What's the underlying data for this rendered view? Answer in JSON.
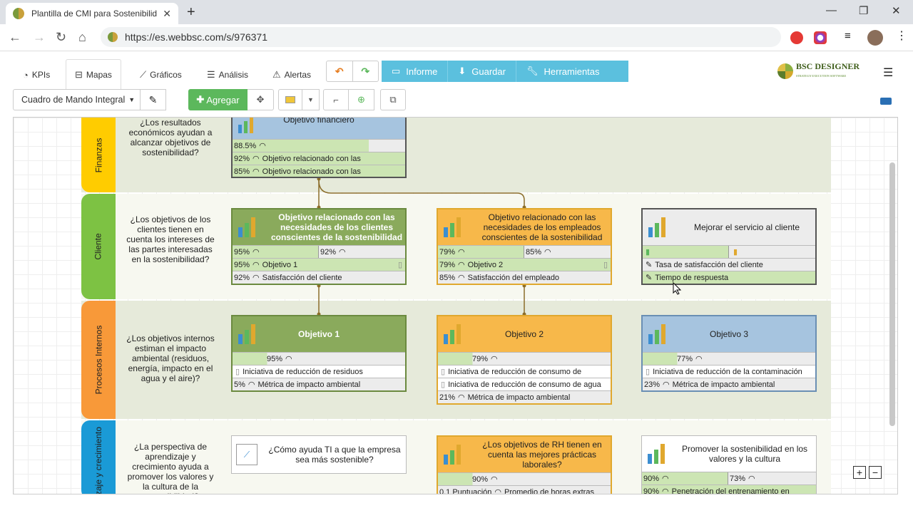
{
  "browser": {
    "tab_title": "Plantilla de CMI para Sostenibilid",
    "url": "https://es.webbsc.com/s/976371"
  },
  "nav": {
    "tabs": [
      {
        "label": "KPIs"
      },
      {
        "label": "Mapas"
      },
      {
        "label": "Gráficos"
      },
      {
        "label": "Análisis"
      },
      {
        "label": "Alertas"
      }
    ],
    "informe": "Informe",
    "guardar": "Guardar",
    "herramientas": "Herramientas",
    "logo": "BSC DESIGNER",
    "logo_sub": "STRATEGY EXECUTION SOFTWARE"
  },
  "toolbar": {
    "scorecard": "Cuadro de Mando Integral",
    "add": "Agregar"
  },
  "perspectives": [
    {
      "name": "Finanzas",
      "question": "¿Los resultados económicos ayudan a alcanzar objetivos de sostenibilidad?"
    },
    {
      "name": "Cliente",
      "question": "¿Los objetivos de los clientes tienen en cuenta los intereses de las partes interesadas en la sostenibilidad?"
    },
    {
      "name": "Procesos Internos",
      "question": "¿Los objetivos internos estiman el impacto ambiental (residuos, energía, impacto en el agua y el aire)?"
    },
    {
      "name": "Aprendizaje y crecimiento",
      "visible_name": "zaje y crecimiento",
      "question": "¿La perspectiva de aprendizaje y crecimiento ayuda a promover los valores y la cultura de la sostenibilidad?"
    }
  ],
  "cards": {
    "fin": {
      "title": "Objetivo financiero",
      "r0": "88.5%",
      "r1p": "92%",
      "r1": "Objetivo relacionado con las",
      "r2p": "85%",
      "r2": "Objetivo relacionado con las"
    },
    "cli1": {
      "title": "Objetivo relacionado con las necesidades de los clientes conscientes de la sostenibilidad",
      "r0a": "95%",
      "r0b": "92%",
      "r1p": "95%",
      "r1": "Objetivo 1",
      "r2p": "92%",
      "r2": "Satisfacción del cliente"
    },
    "cli2": {
      "title": "Objetivo relacionado con las necesidades de los empleados conscientes de la sostenibilidad",
      "r0a": "79%",
      "r0b": "85%",
      "r1p": "79%",
      "r1": "Objetivo 2",
      "r2p": "85%",
      "r2": "Satisfacción del empleado"
    },
    "cli3": {
      "title": "Mejorar el servicio al cliente",
      "r1": "Tasa de satisfacción del cliente",
      "r2": "Tiempo de respuesta"
    },
    "pi1": {
      "title": "Objetivo 1",
      "r0": "95%",
      "r1": "Iniciativa de reducción de residuos",
      "r2p": "5%",
      "r2": "Métrica de impacto ambiental"
    },
    "pi2": {
      "title": "Objetivo 2",
      "r0": "79%",
      "r1": "Iniciativa de reducción de consumo de",
      "r2": "Iniciativa de reducción de consumo de agua",
      "r3p": "21%",
      "r3": "Métrica de impacto ambiental"
    },
    "pi3": {
      "title": "Objetivo 3",
      "r0": "77%",
      "r1": "Iniciativa de reducción de la contaminación",
      "r2p": "23%",
      "r2": "Métrica de impacto ambiental"
    },
    "ac1": {
      "title": "¿Cómo ayuda TI a que la empresa sea más sostenible?"
    },
    "ac2": {
      "title": "¿Los objetivos de RH tienen en cuenta las mejores prácticas laborales?",
      "r0": "90%",
      "r1p": "0.1 Puntuación",
      "r1": "Promedio de horas extras"
    },
    "ac3": {
      "title": "Promover la sostenibilidad en los valores y la cultura",
      "r0a": "90%",
      "r0b": "73%",
      "r1p": "90%",
      "r1": "Penetración del entrenamiento en"
    }
  },
  "colors": {
    "green": "#8aaa5c",
    "orange": "#f7b84a",
    "blue": "#a6c4df",
    "grey": "#ececec",
    "lightgreen": "#cce5b3"
  }
}
